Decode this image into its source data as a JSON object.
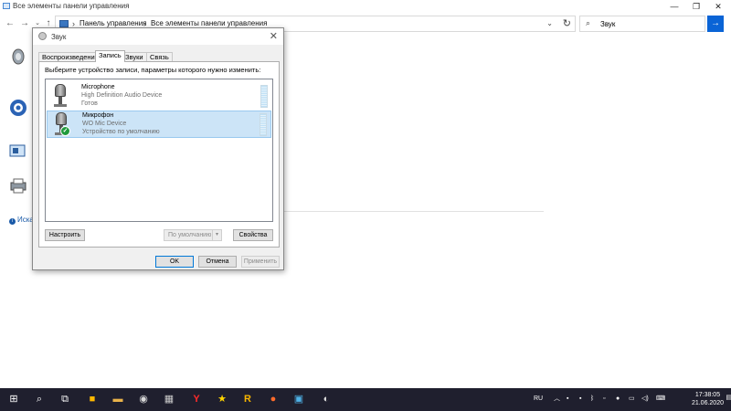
{
  "explorer": {
    "window_title": "Все элементы панели управления",
    "breadcrumb": [
      "Панель управления",
      "Все элементы панели управления"
    ],
    "search_value": "Звук",
    "side_link": "Иска"
  },
  "dialog": {
    "title": "Звук",
    "tabs": [
      {
        "label": "Воспроизведение",
        "active": false
      },
      {
        "label": "Запись",
        "active": true
      },
      {
        "label": "Звуки",
        "active": false
      },
      {
        "label": "Связь",
        "active": false
      }
    ],
    "prompt": "Выберите устройство записи, параметры которого нужно изменить:",
    "devices": [
      {
        "name": "Microphone",
        "description": "High Definition Audio Device",
        "status": "Готов",
        "selected": false,
        "default": false
      },
      {
        "name": "Микрофон",
        "description": "WO Mic Device",
        "status": "Устройство по умолчанию",
        "selected": true,
        "default": true
      }
    ],
    "buttons": {
      "configure": "Настроить",
      "set_default": "По умолчанию",
      "properties": "Свойства",
      "ok": "OK",
      "cancel": "Отмена",
      "apply": "Применить"
    }
  },
  "taskbar": {
    "language": "RU",
    "time": "17:38:05",
    "date": "21.06.2020",
    "accent_color": "#1f1f2e"
  }
}
